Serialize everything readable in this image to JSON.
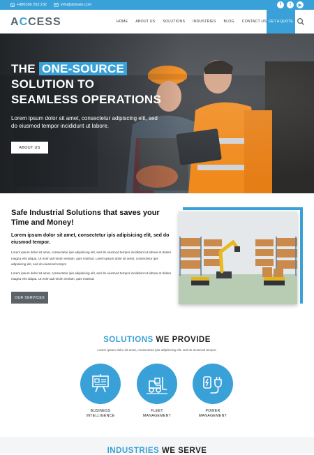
{
  "topbar": {
    "phone": "+880166 253 232",
    "email": "info@domain.com",
    "social": [
      {
        "icon": "facebook-icon",
        "glyph": "f"
      },
      {
        "icon": "twitter-icon",
        "glyph": "t"
      },
      {
        "icon": "youtube-icon",
        "glyph": "▶"
      }
    ]
  },
  "nav": {
    "logo_a": "A",
    "logo_x": "C",
    "logo_rest": "CESS",
    "items": [
      "HOME",
      "ABOUT US",
      "SOLUTIONS",
      "INDUSTRIES",
      "BLOG",
      "CONTACT US"
    ],
    "quote": "GET A QUOTE",
    "search_icon": "search-icon"
  },
  "hero": {
    "title_pre": "THE ",
    "title_highlight": "ONE-SOURCE",
    "title_line2": "SOLUTION TO",
    "title_line3": "SEAMLESS OPERATIONS",
    "subtitle": "Lorem ipsum dolor sit amet, consectetur adipiscing elit, sed do eiusmod tempor incididunt ut labore.",
    "button": "ABOUT US"
  },
  "about": {
    "heading": "Safe Industrial Solutions that saves your Time and Money!",
    "lead": "Lorem ipsum dolor sit amet, consectetur ipis adipisicing elit, sed do eiusmod tempor.",
    "para1": "Lorem ipsum dolor sit amet, consectetur ipis adipisicing elit, sed do eiusmod tempor incididunt ut labore et dolore magna eris aliqua. Ut enim ad minim veniam, quis nostrud. Lorem ipsum dolor sit amet, consectetur ipis adipisicing elit, sed do eiusmod tempor",
    "para2": "Lorem ipsum dolor sit amet, consectetur ipis adipisicing elit, sed do eiusmod tempor incididunt ut labore et dolore magna eris aliqua. Ut enim ad minim veniam, quis nostrud.",
    "button": "OUR SERVICES"
  },
  "solutions": {
    "title_blue": "SOLUTIONS",
    "title_rest": " WE PROVIDE",
    "subtitle": "Lorem ipsum dolor sit amet, consectetur ipis adipisicing elit, sed do eiusmod tempor.",
    "items": [
      {
        "line1": "BUSINESS",
        "line2": "INTELLIGENCE",
        "icon": "presentation-board-icon"
      },
      {
        "line1": "FLEET",
        "line2": "MANAGEMENT",
        "icon": "forklift-icon"
      },
      {
        "line1": "POWER",
        "line2": "MANAGEMENT",
        "icon": "power-plug-icon"
      }
    ]
  },
  "industries": {
    "title_blue": "INDUSTRIES",
    "title_rest": " WE SERVE"
  },
  "colors": {
    "accent": "#3aa1d8",
    "dark_button": "#5c6368"
  }
}
